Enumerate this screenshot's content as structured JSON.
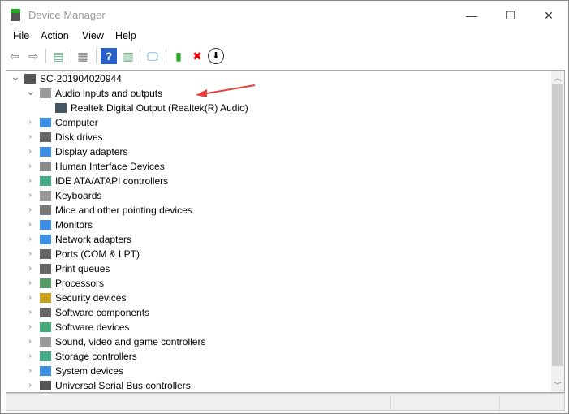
{
  "window": {
    "title": "Device Manager",
    "minimize": "—",
    "maximize": "☐",
    "close": "✕"
  },
  "menu": [
    "File",
    "Action",
    "View",
    "Help"
  ],
  "toolbar": [
    {
      "name": "back-icon",
      "glyph": "⇦",
      "color": "#777"
    },
    {
      "name": "forward-icon",
      "glyph": "⇨",
      "color": "#777"
    },
    {
      "name": "show-hide-console-tree-icon",
      "glyph": "▤",
      "color": "#5a7"
    },
    {
      "name": "properties-icon",
      "glyph": "▦",
      "color": "#777"
    },
    {
      "name": "help-icon",
      "glyph": "?",
      "color": "#fff"
    },
    {
      "name": "action-pane-icon",
      "glyph": "▥",
      "color": "#5a7"
    },
    {
      "name": "scan-hardware-icon",
      "glyph": "🖵",
      "color": "#2a8ad4"
    },
    {
      "name": "update-driver-icon",
      "glyph": "▮",
      "color": "#2a2"
    },
    {
      "name": "uninstall-device-icon",
      "glyph": "✖",
      "color": "#e00"
    },
    {
      "name": "disable-device-icon",
      "glyph": "⬇",
      "color": "#000"
    }
  ],
  "tree": {
    "root": "SC-201904020944",
    "expanded": {
      "label": "Audio inputs and outputs",
      "children": [
        "Realtek Digital Output (Realtek(R) Audio)"
      ]
    },
    "categories": [
      {
        "label": "Computer",
        "color": "#3a8ee6"
      },
      {
        "label": "Disk drives",
        "color": "#666"
      },
      {
        "label": "Display adapters",
        "color": "#3a8ee6"
      },
      {
        "label": "Human Interface Devices",
        "color": "#888"
      },
      {
        "label": "IDE ATA/ATAPI controllers",
        "color": "#4a8"
      },
      {
        "label": "Keyboards",
        "color": "#999"
      },
      {
        "label": "Mice and other pointing devices",
        "color": "#777"
      },
      {
        "label": "Monitors",
        "color": "#3a8ee6"
      },
      {
        "label": "Network adapters",
        "color": "#3a8ee6"
      },
      {
        "label": "Ports (COM & LPT)",
        "color": "#666"
      },
      {
        "label": "Print queues",
        "color": "#666"
      },
      {
        "label": "Processors",
        "color": "#596"
      },
      {
        "label": "Security devices",
        "color": "#c9a020"
      },
      {
        "label": "Software components",
        "color": "#666"
      },
      {
        "label": "Software devices",
        "color": "#4a7"
      },
      {
        "label": "Sound, video and game controllers",
        "color": "#999"
      },
      {
        "label": "Storage controllers",
        "color": "#4a8"
      },
      {
        "label": "System devices",
        "color": "#3a8ee6"
      },
      {
        "label": "Universal Serial Bus controllers",
        "color": "#555"
      }
    ]
  },
  "annotation_color": "#e8413b"
}
